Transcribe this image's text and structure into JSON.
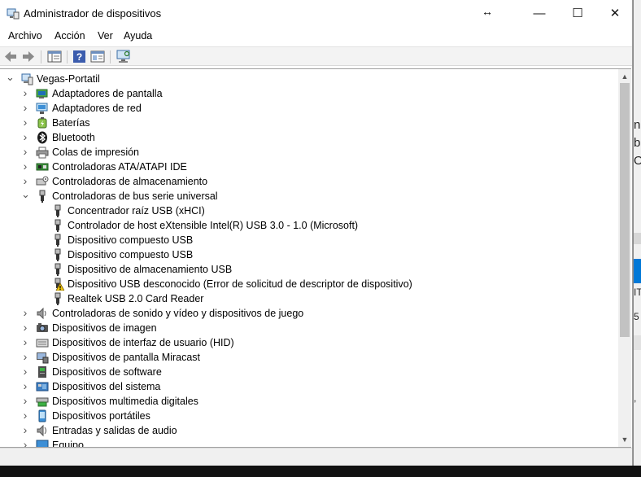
{
  "window": {
    "title": "Administrador de dispositivos",
    "cursor_glyph": "↔",
    "minimize_glyph": "—",
    "maximize_glyph": "☐",
    "close_glyph": "✕"
  },
  "menu": {
    "items": [
      "Archivo",
      "Acción",
      "Ver",
      "Ayuda"
    ]
  },
  "toolbar": {
    "icons": [
      "back-arrow-icon",
      "forward-arrow-icon",
      "show-hide-console-tree-icon",
      "help-icon",
      "properties-icon",
      "scan-hardware-monitor-icon"
    ]
  },
  "tree": {
    "root": "Vegas-Portatil",
    "categories": [
      "Adaptadores de pantalla",
      "Adaptadores de red",
      "Baterías",
      "Bluetooth",
      "Colas de impresión",
      "Controladoras ATA/ATAPI IDE",
      "Controladoras de almacenamiento",
      "Controladoras de bus serie universal",
      "Controladoras de sonido y vídeo y dispositivos de juego",
      "Dispositivos de imagen",
      "Dispositivos de interfaz de usuario (HID)",
      "Dispositivos de pantalla Miracast",
      "Dispositivos de software",
      "Dispositivos del sistema",
      "Dispositivos multimedia digitales",
      "Dispositivos portátiles",
      "Entradas y salidas de audio",
      "Equipo"
    ],
    "usb_children": [
      "Concentrador raíz USB (xHCI)",
      "Controlador de host eXtensible Intel(R) USB 3.0 - 1.0 (Microsoft)",
      "Dispositivo compuesto USB",
      "Dispositivo compuesto USB",
      "Dispositivo de almacenamiento USB",
      "Dispositivo USB desconocido (Error de solicitud de descriptor de dispositivo)",
      "Realtek USB 2.0 Card Reader"
    ]
  },
  "background_window": {
    "fragments": [
      "n",
      "b",
      "O",
      "IT",
      "5",
      ","
    ]
  },
  "colors": {
    "accent": "#0078d7",
    "warning": "#f2c811",
    "scroll_thumb": "#c2c2c2"
  }
}
